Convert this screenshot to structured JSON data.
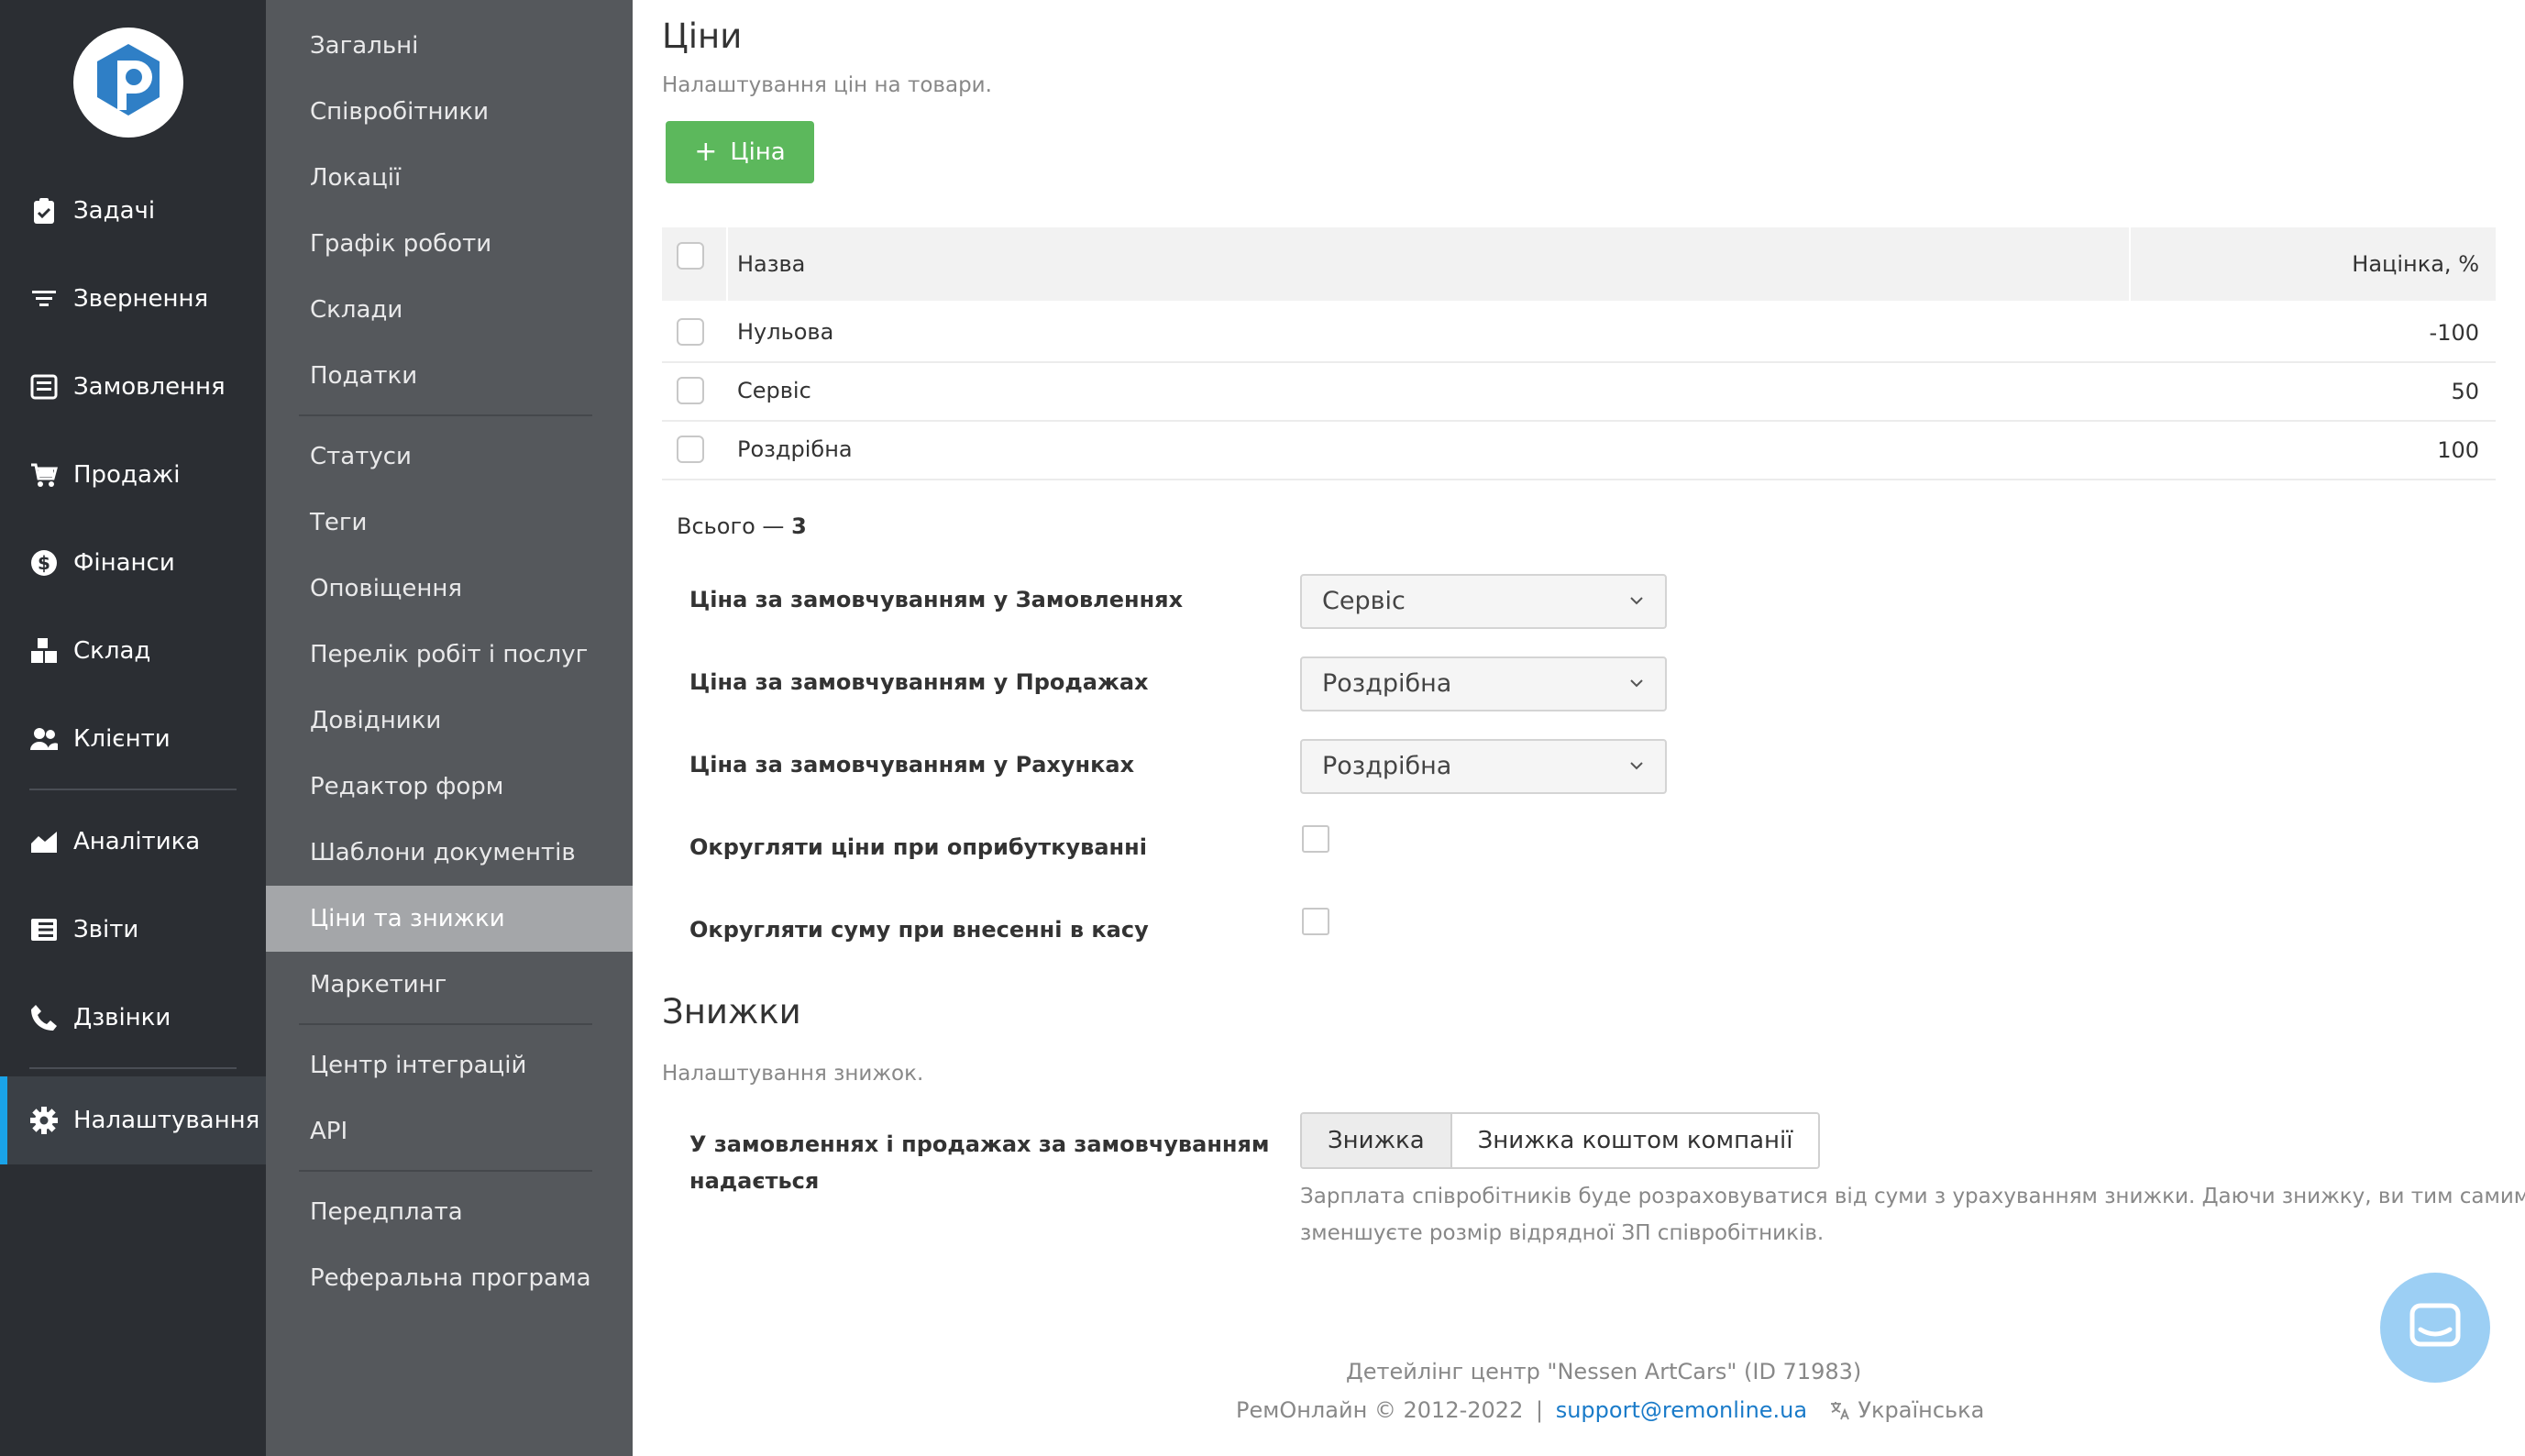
{
  "nav": {
    "items": [
      {
        "label": "Задачі",
        "icon": "clipboard-check-icon"
      },
      {
        "label": "Звернення",
        "icon": "filter-lines-icon"
      },
      {
        "label": "Замовлення",
        "icon": "order-form-icon"
      },
      {
        "label": "Продажі",
        "icon": "cart-icon"
      },
      {
        "label": "Фінанси",
        "icon": "dollar-circle-icon"
      },
      {
        "label": "Склад",
        "icon": "boxes-icon"
      },
      {
        "label": "Клієнти",
        "icon": "users-icon"
      },
      {
        "label": "Аналітика",
        "icon": "area-chart-icon"
      },
      {
        "label": "Звіти",
        "icon": "report-list-icon"
      },
      {
        "label": "Дзвінки",
        "icon": "phone-icon"
      },
      {
        "label": "Налаштування",
        "icon": "gear-icon"
      }
    ],
    "active": "Налаштування"
  },
  "settings_menu": {
    "items": [
      "Загальні",
      "Співробітники",
      "Локації",
      "Графік роботи",
      "Склади",
      "Податки",
      "Статуси",
      "Теги",
      "Оповіщення",
      "Перелік робіт і послуг",
      "Довідники",
      "Редактор форм",
      "Шаблони документів",
      "Ціни та знижки",
      "Маркетинг",
      "Центр інтеграцій",
      "API",
      "Передплата",
      "Реферальна програма"
    ],
    "active": "Ціни та знижки"
  },
  "prices": {
    "title": "Ціни",
    "subtitle": "Налаштування цін на товари.",
    "add_button": "Ціна",
    "table": {
      "columns": [
        "Назва",
        "Націнка, %"
      ],
      "rows": [
        {
          "name": "Нульова",
          "markup": "-100"
        },
        {
          "name": "Сервіс",
          "markup": "50"
        },
        {
          "name": "Роздрібна",
          "markup": "100"
        }
      ]
    },
    "total_label": "Всього —",
    "total_value": "3",
    "fields": {
      "default_orders": {
        "label": "Ціна за замовчуванням у Замовленнях",
        "value": "Сервіс"
      },
      "default_sales": {
        "label": "Ціна за замовчуванням у Продажах",
        "value": "Роздрібна"
      },
      "default_invoices": {
        "label": "Ціна за замовчуванням у Рахунках",
        "value": "Роздрібна"
      },
      "round_prices": {
        "label": "Округляти ціни при оприбуткуванні",
        "checked": false
      },
      "round_sum": {
        "label": "Округляти суму при внесенні в касу",
        "checked": false
      }
    }
  },
  "discounts": {
    "title": "Знижки",
    "subtitle": "Налаштування знижок.",
    "default_label_line1": "У замовленнях і продажах за замовчуванням",
    "default_label_line2": "надається",
    "options": [
      "Знижка",
      "Знижка коштом компанії"
    ],
    "selected": "Знижка",
    "note_line1": "Зарплата співробітників буде розраховуватися від суми з урахуванням знижки. Даючи знижку, ви тим самим",
    "note_line2": "зменшуєте розмір відрядної ЗП співробітників."
  },
  "footer": {
    "company": "Детейлінг центр \"Nessen ArtCars\" (ID 71983)",
    "copyright": "РемОнлайн © 2012-2022",
    "separator": "|",
    "email": "support@remonline.ua",
    "language": "Українська"
  },
  "colors": {
    "nav_bg": "#2b2e33",
    "menu_bg": "#55585c",
    "menu_active": "#a4a6a9",
    "accent": "#1aa3e8",
    "add_button": "#5cb85c",
    "link": "#1a7bc9",
    "chat_button": "#9ccff4"
  },
  "icons": {
    "logo": "remonline-logo",
    "chat": "chat-bubble-icon",
    "language": "translate-icon",
    "select": "chevron-down-icon"
  }
}
